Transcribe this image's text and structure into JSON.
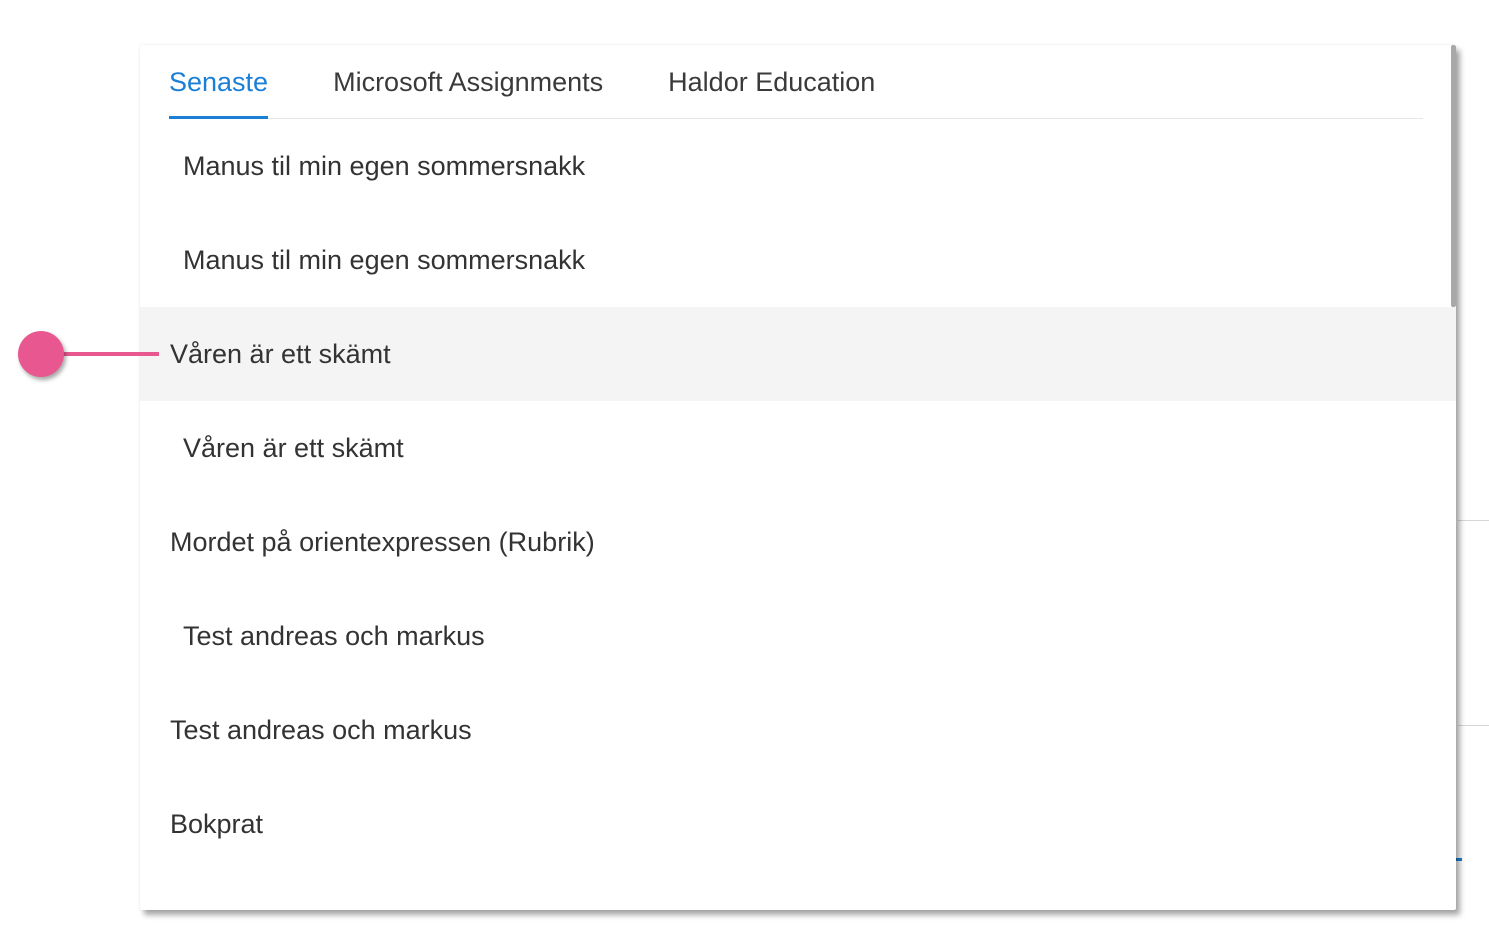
{
  "tabs": [
    {
      "label": "Senaste",
      "active": true
    },
    {
      "label": "Microsoft Assignments",
      "active": false
    },
    {
      "label": "Haldor Education",
      "active": false
    }
  ],
  "items": [
    {
      "label": "Manus til min egen sommersnakk",
      "indent": true
    },
    {
      "label": "Manus til min egen sommersnakk",
      "indent": true
    },
    {
      "label": "Våren är ett skämt",
      "indent": false,
      "hovered": true
    },
    {
      "label": "Våren är ett skämt",
      "indent": true
    },
    {
      "label": "Mordet på orientexpressen (Rubrik)",
      "indent": false
    },
    {
      "label": "Test andreas och markus",
      "indent": true
    },
    {
      "label": "Test andreas och markus",
      "indent": false
    },
    {
      "label": "Bokprat",
      "indent": false
    }
  ],
  "colors": {
    "accent": "#1b7fd6",
    "callout": "#e8578f",
    "hover_bg": "#f4f4f4"
  }
}
